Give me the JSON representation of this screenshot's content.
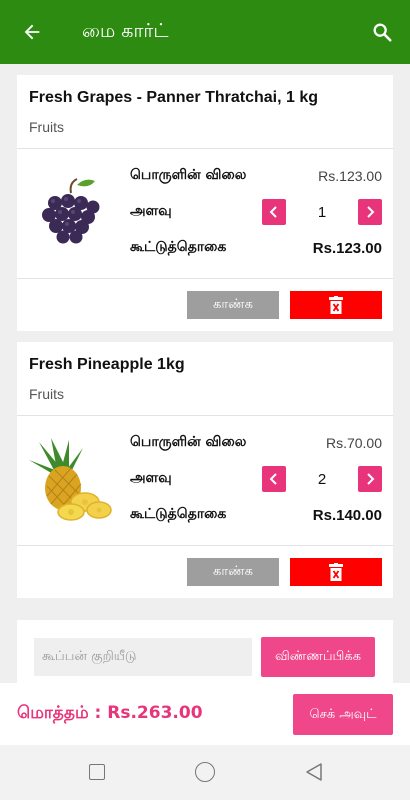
{
  "appbar": {
    "title": "மை கார்ட்"
  },
  "items": [
    {
      "name": "Fresh Grapes - Panner Thratchai, 1 kg",
      "category": "Fruits",
      "price_label": "பொருளின் விலை",
      "price": "Rs.123.00",
      "qty_label": "அளவு",
      "qty": "1",
      "subtotal_label": "கூட்டுத்தொகை",
      "subtotal": "Rs.123.00",
      "view_label": "காண்க"
    },
    {
      "name": "Fresh Pineapple 1kg",
      "category": "Fruits",
      "price_label": "பொருளின் விலை",
      "price": "Rs.70.00",
      "qty_label": "அளவு",
      "qty": "2",
      "subtotal_label": "கூட்டுத்தொகை",
      "subtotal": "Rs.140.00",
      "view_label": "காண்க"
    }
  ],
  "coupon": {
    "placeholder": "கூப்பன் குறியீடு",
    "apply_label": "விண்ணப்பிக்க"
  },
  "footer": {
    "total": "மொத்தம் : Rs.263.00",
    "checkout_label": "செக் அவுட்"
  },
  "colors": {
    "appbar": "#2e8b12",
    "accent": "#e8347a",
    "delete": "#ff0000",
    "view": "#9e9e9e"
  }
}
